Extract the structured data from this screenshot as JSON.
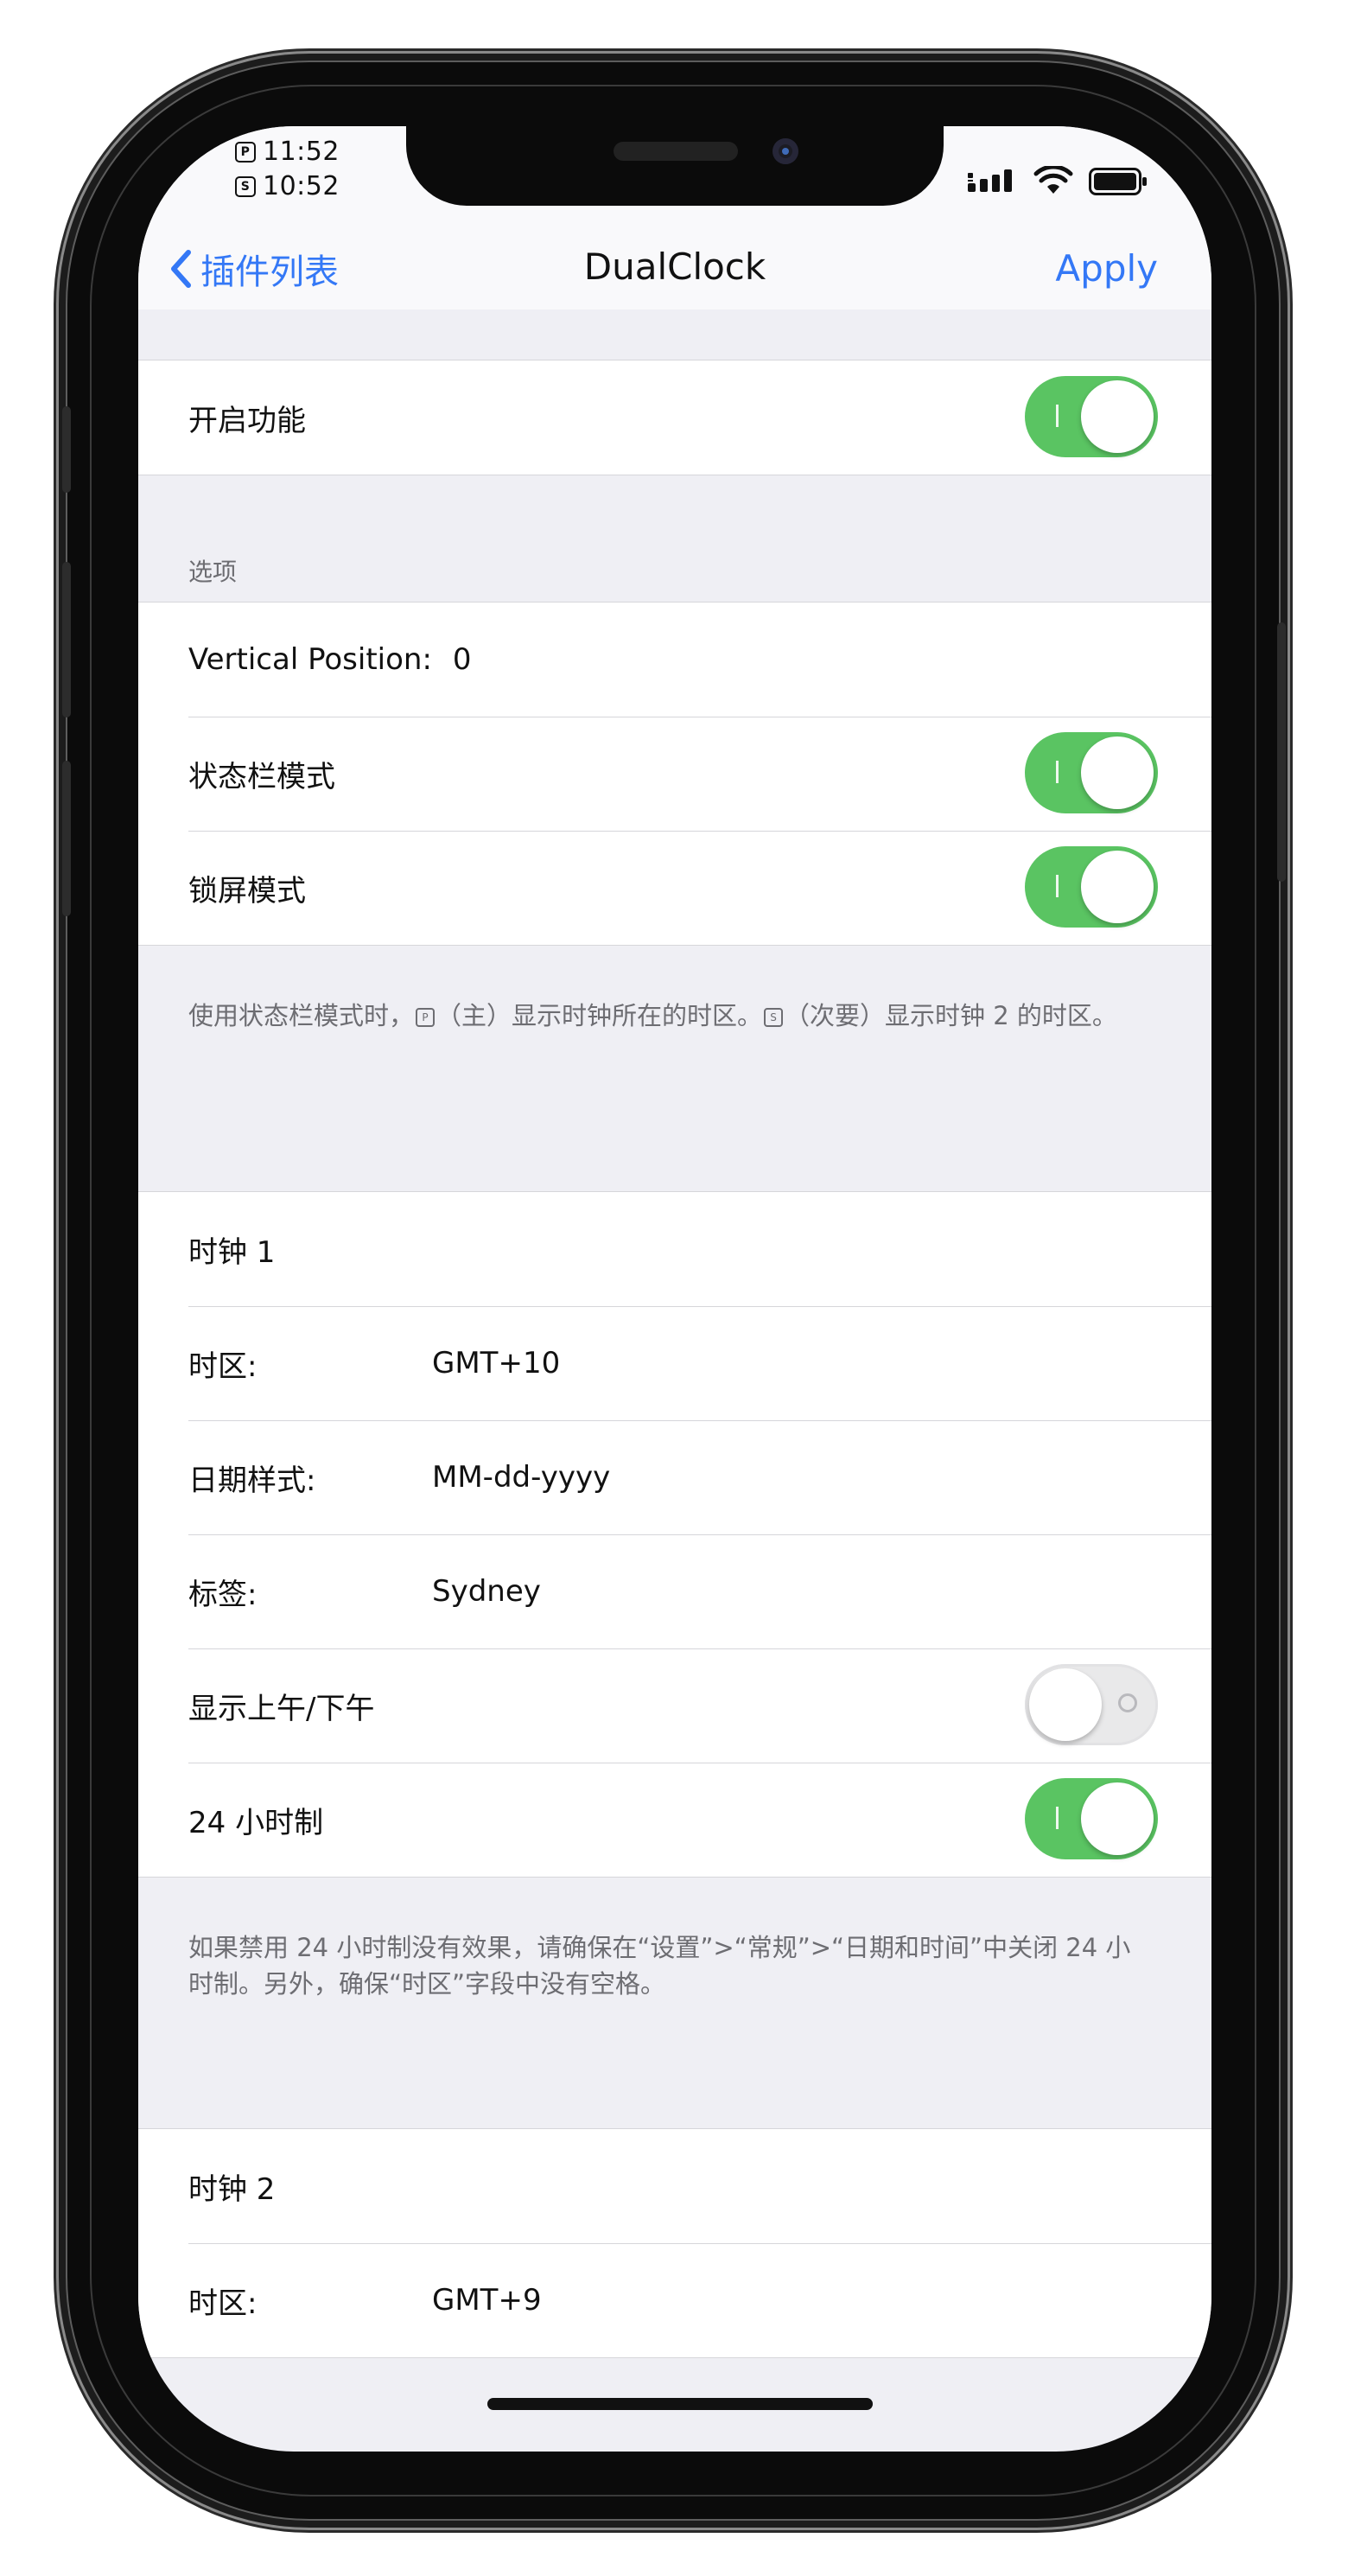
{
  "status_bar": {
    "primary_time": "11:52",
    "secondary_time": "10:52",
    "primary_marker": "P",
    "secondary_marker": "S",
    "icons": [
      "signal-icon",
      "wifi-icon",
      "battery-icon"
    ]
  },
  "nav": {
    "back_label": "插件列表",
    "title": "DualClock",
    "apply_label": "Apply",
    "accent_color": "#3478f6"
  },
  "enable": {
    "label": "开启功能",
    "on": true
  },
  "options": {
    "header": "选项",
    "vertical_position_label": "Vertical Position:",
    "vertical_position_value": "0",
    "statusbar_mode_label": "状态栏模式",
    "statusbar_mode_on": true,
    "lockscreen_mode_label": "锁屏模式",
    "lockscreen_mode_on": true,
    "footer_part1": "使用状态栏模式时，",
    "footer_marker_p": "P",
    "footer_part2": "（主）显示时钟所在的时区。",
    "footer_marker_s": "S",
    "footer_part3": "（次要）显示时钟 2 的时区。"
  },
  "clock1": {
    "title": "时钟 1",
    "timezone_label": "时区:",
    "timezone_value": "GMT+10",
    "date_format_label": "日期样式:",
    "date_format_value": "MM-dd-yyyy",
    "tag_label": "标签:",
    "tag_value": "Sydney",
    "ampm_label": "显示上午/下午",
    "ampm_on": false,
    "h24_label": "24 小时制",
    "h24_on": true,
    "footer": "如果禁用 24 小时制没有效果，请确保在“设置”>“常规”>“日期和时间”中关闭 24 小时制。另外，确保“时区”字段中没有空格。"
  },
  "clock2": {
    "title": "时钟 2",
    "timezone_label": "时区:",
    "timezone_value": "GMT+9"
  },
  "colors": {
    "toggle_on": "#5ac462",
    "toggle_off": "#e9e9ea",
    "group_background": "#efeff4"
  }
}
